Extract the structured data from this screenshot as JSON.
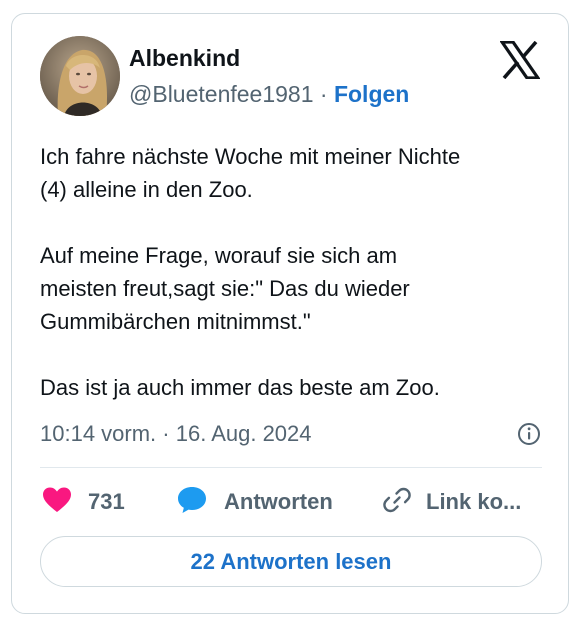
{
  "author": {
    "display_name": "Albenkind",
    "handle": "@Bluetenfee1981",
    "separator": "·",
    "follow_label": "Folgen"
  },
  "tweet": {
    "lines": [
      "Ich fahre nächste Woche mit meiner Nichte",
      "(4) alleine in den Zoo.",
      "",
      "Auf meine Frage, worauf sie sich am",
      "meisten freut,sagt sie:\" Das du wieder",
      "Gummibärchen mitnimmst.\"",
      "",
      "Das ist ja auch immer das beste am Zoo."
    ],
    "timestamp": "10:14 vorm. · 16. Aug. 2024"
  },
  "actions": {
    "like_count": "731",
    "reply_label": "Antworten",
    "copy_link_label": "Link ko..."
  },
  "read_replies_label": "22 Antworten lesen",
  "icons": {
    "platform": "x-logo-icon",
    "like": "heart-icon",
    "reply": "speech-bubble-icon",
    "copy": "link-icon",
    "info": "info-icon"
  },
  "colors": {
    "like": "#f91880",
    "reply": "#1d9bf0",
    "link_text": "#1d72c9",
    "secondary_text": "#536471",
    "primary_text": "#0f1419",
    "border": "#cfd9de"
  }
}
